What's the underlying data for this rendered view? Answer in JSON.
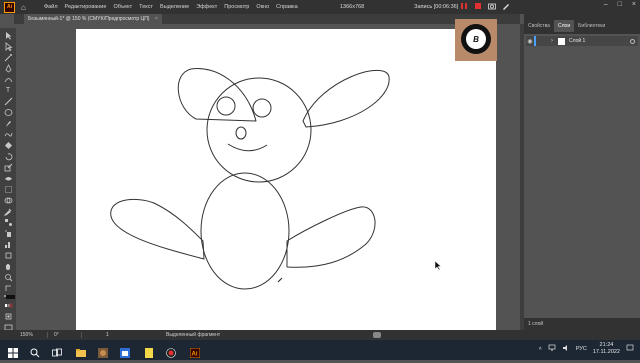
{
  "app": {
    "logo": "Ai"
  },
  "menu": [
    "Файл",
    "Редактирование",
    "Объект",
    "Текст",
    "Выделение",
    "Эффект",
    "Просмотр",
    "Окно",
    "Справка"
  ],
  "recorder": {
    "resolution": "1366x768",
    "status": "Запись [00:06:36]"
  },
  "document_tab": {
    "title": "Безымянный-1* @ 150 % (CMYK/Предпросмотр ЦП)",
    "close": "×"
  },
  "webcam": {
    "badge_letter": "B"
  },
  "panel": {
    "tabs": [
      "Свойства",
      "Слои",
      "Библиотеки"
    ],
    "active_tab": "Слои",
    "layer": {
      "name": "Слой 1"
    },
    "footer": "1 слой"
  },
  "status": {
    "zoom": "150%",
    "rotation": "0°",
    "page": "1",
    "mode": "Выделенный фрагмент"
  },
  "tray": {
    "lang": "РУС",
    "time": "21:24",
    "date": "17.11.2022"
  },
  "colors": {
    "accent": "#ff9a00",
    "layer_color": "#4aa3ff",
    "record_red": "#e03030"
  },
  "icons": [
    "home-icon",
    "selection-tool-icon",
    "pen-tool-icon",
    "type-tool-icon",
    "search-icon",
    "windows-start-icon"
  ]
}
